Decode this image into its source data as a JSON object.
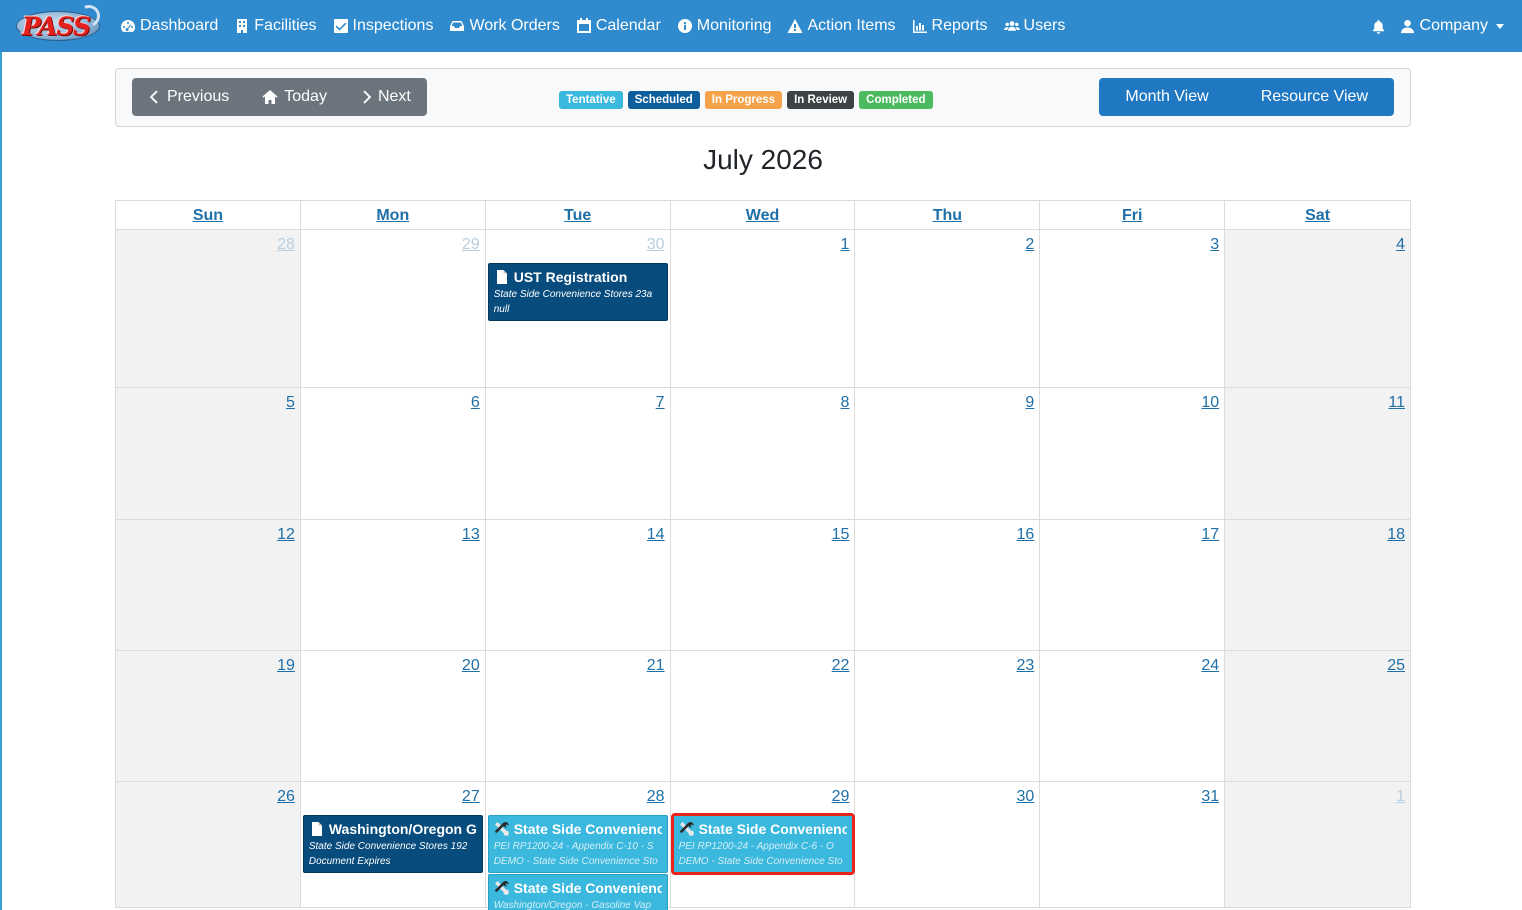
{
  "brand": {
    "logo_text": "PASS"
  },
  "nav": {
    "items": [
      {
        "label": "Dashboard",
        "icon": "dashboard-icon"
      },
      {
        "label": "Facilities",
        "icon": "building-icon"
      },
      {
        "label": "Inspections",
        "icon": "check-square-icon"
      },
      {
        "label": "Work Orders",
        "icon": "tray-icon"
      },
      {
        "label": "Calendar",
        "icon": "calendar-icon"
      },
      {
        "label": "Monitoring",
        "icon": "info-circle-icon"
      },
      {
        "label": "Action Items",
        "icon": "warning-icon"
      },
      {
        "label": "Reports",
        "icon": "bar-chart-icon"
      },
      {
        "label": "Users",
        "icon": "users-icon"
      }
    ],
    "company_label": "Company"
  },
  "toolbar": {
    "previous_label": "Previous",
    "today_label": "Today",
    "next_label": "Next",
    "legend": [
      {
        "label": "Tentative",
        "color": "#3bb8de"
      },
      {
        "label": "Scheduled",
        "color": "#0d5e9c"
      },
      {
        "label": "In Progress",
        "color": "#f6a24a"
      },
      {
        "label": "In Review",
        "color": "#3f4244"
      },
      {
        "label": "Completed",
        "color": "#4cba5f"
      }
    ],
    "month_view_label": "Month View",
    "resource_view_label": "Resource View"
  },
  "calendar": {
    "title": "July 2026",
    "day_names": [
      "Sun",
      "Mon",
      "Tue",
      "Wed",
      "Thu",
      "Fri",
      "Sat"
    ],
    "weeks": [
      {
        "days": [
          {
            "num": "28",
            "other": true,
            "events": []
          },
          {
            "num": "29",
            "other": true,
            "events": []
          },
          {
            "num": "30",
            "other": true,
            "events": [
              {
                "title": "UST Registration",
                "line1": "State Side Convenience Stores 23a",
                "line2": "null",
                "status": "scheduled",
                "icon": "document-icon",
                "selected": false
              }
            ]
          },
          {
            "num": "1",
            "other": false,
            "events": []
          },
          {
            "num": "2",
            "other": false,
            "events": []
          },
          {
            "num": "3",
            "other": false,
            "events": []
          },
          {
            "num": "4",
            "other": false,
            "events": []
          }
        ]
      },
      {
        "days": [
          {
            "num": "5",
            "other": false,
            "events": []
          },
          {
            "num": "6",
            "other": false,
            "events": []
          },
          {
            "num": "7",
            "other": false,
            "events": []
          },
          {
            "num": "8",
            "other": false,
            "events": []
          },
          {
            "num": "9",
            "other": false,
            "events": []
          },
          {
            "num": "10",
            "other": false,
            "events": []
          },
          {
            "num": "11",
            "other": false,
            "events": []
          }
        ]
      },
      {
        "days": [
          {
            "num": "12",
            "other": false,
            "events": []
          },
          {
            "num": "13",
            "other": false,
            "events": []
          },
          {
            "num": "14",
            "other": false,
            "events": []
          },
          {
            "num": "15",
            "other": false,
            "events": []
          },
          {
            "num": "16",
            "other": false,
            "events": []
          },
          {
            "num": "17",
            "other": false,
            "events": []
          },
          {
            "num": "18",
            "other": false,
            "events": []
          }
        ]
      },
      {
        "days": [
          {
            "num": "19",
            "other": false,
            "events": []
          },
          {
            "num": "20",
            "other": false,
            "events": []
          },
          {
            "num": "21",
            "other": false,
            "events": []
          },
          {
            "num": "22",
            "other": false,
            "events": []
          },
          {
            "num": "23",
            "other": false,
            "events": []
          },
          {
            "num": "24",
            "other": false,
            "events": []
          },
          {
            "num": "25",
            "other": false,
            "events": []
          }
        ]
      },
      {
        "days": [
          {
            "num": "26",
            "other": false,
            "events": []
          },
          {
            "num": "27",
            "other": false,
            "events": [
              {
                "title": "Washington/Oregon G",
                "line1": "State Side Convenience Stores 192",
                "line2": "Document Expires",
                "status": "scheduled",
                "icon": "document-icon",
                "selected": false
              }
            ]
          },
          {
            "num": "28",
            "other": false,
            "events": [
              {
                "title": "State Side Convenienc",
                "line1": "PEI RP1200-24 - Appendix C-10 - S",
                "line2": "DEMO - State Side Convenience Sto",
                "status": "tentative",
                "icon": "tools-icon",
                "selected": false
              },
              {
                "title": "State Side Convenienc",
                "line1": "Washington/Oregon - Gasoline Vap",
                "line2": "",
                "status": "tentative",
                "icon": "tools-icon",
                "selected": false
              }
            ]
          },
          {
            "num": "29",
            "other": false,
            "events": [
              {
                "title": "State Side Convenienc",
                "line1": "PEI RP1200-24 - Appendix C-6 - O",
                "line2": "DEMO - State Side Convenience Sto",
                "status": "tentative",
                "icon": "tools-icon",
                "selected": true
              }
            ]
          },
          {
            "num": "30",
            "other": false,
            "events": []
          },
          {
            "num": "31",
            "other": false,
            "events": []
          },
          {
            "num": "1",
            "other": true,
            "events": []
          }
        ]
      }
    ]
  }
}
